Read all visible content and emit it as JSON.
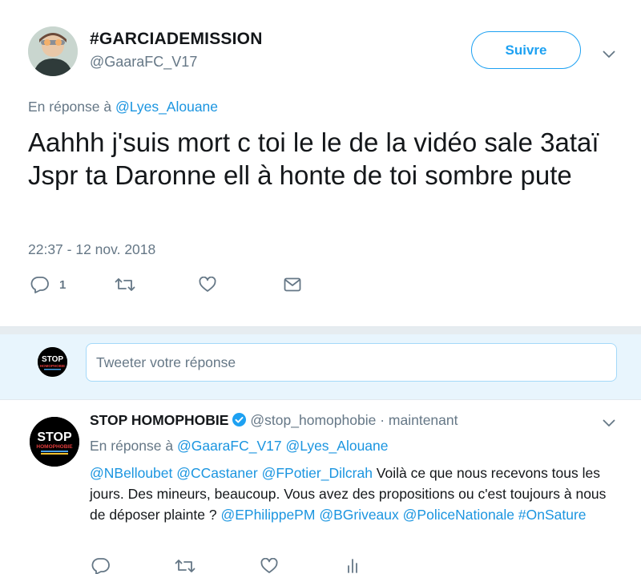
{
  "main_tweet": {
    "display_name": "#GARCIADEMISSION",
    "handle": "@GaaraFC_V17",
    "follow_label": "Suivre",
    "reply_prefix": "En réponse à",
    "reply_mention": "@Lyes_Alouane",
    "text": "Aahhh j'suis mort c toi le le de la vidéo sale 3ataï Jspr ta Daronne ell à honte de toi sombre pute",
    "timestamp": "22:37 - 12 nov. 2018",
    "reply_count": "1"
  },
  "compose": {
    "avatar_text_top": "STOP",
    "avatar_text_bottom": "HOMOPHOBIE",
    "placeholder": "Tweeter votre réponse"
  },
  "reply_tweet": {
    "display_name": "STOP HOMOPHOBIE",
    "handle": "@stop_homophobie",
    "separator": "·",
    "time": "maintenant",
    "reply_prefix": "En réponse à",
    "reply_mentions": [
      "@GaaraFC_V17",
      "@Lyes_Alouane"
    ],
    "avatar_text_top": "STOP",
    "avatar_text_bottom": "HOMOPHOBIE",
    "text_parts": [
      {
        "type": "mention",
        "text": "@NBelloubet"
      },
      {
        "type": "text",
        "text": " "
      },
      {
        "type": "mention",
        "text": "@CCastaner"
      },
      {
        "type": "text",
        "text": " "
      },
      {
        "type": "mention",
        "text": "@FPotier_Dilcrah"
      },
      {
        "type": "text",
        "text": " Voilà ce que nous recevons tous les jours. Des mineurs, beaucoup. Vous avez des propositions ou c'est toujours à nous de déposer plainte ? "
      },
      {
        "type": "mention",
        "text": "@EPhilippePM"
      },
      {
        "type": "text",
        "text": " "
      },
      {
        "type": "mention",
        "text": "@BGriveaux"
      },
      {
        "type": "text",
        "text": " "
      },
      {
        "type": "mention",
        "text": "@PoliceNationale"
      },
      {
        "type": "text",
        "text": " "
      },
      {
        "type": "mention",
        "text": "#OnSature"
      }
    ]
  },
  "icons": {
    "reply": "reply-icon",
    "retweet": "retweet-icon",
    "like": "heart-icon",
    "dm": "envelope-icon",
    "analytics": "analytics-icon",
    "more": "chevron-down-icon",
    "verified": "verified-badge-icon"
  },
  "colors": {
    "accent": "#1da1f2",
    "link": "#1b95e0",
    "secondary_text": "#657786",
    "compose_bg": "#e8f5fd"
  }
}
